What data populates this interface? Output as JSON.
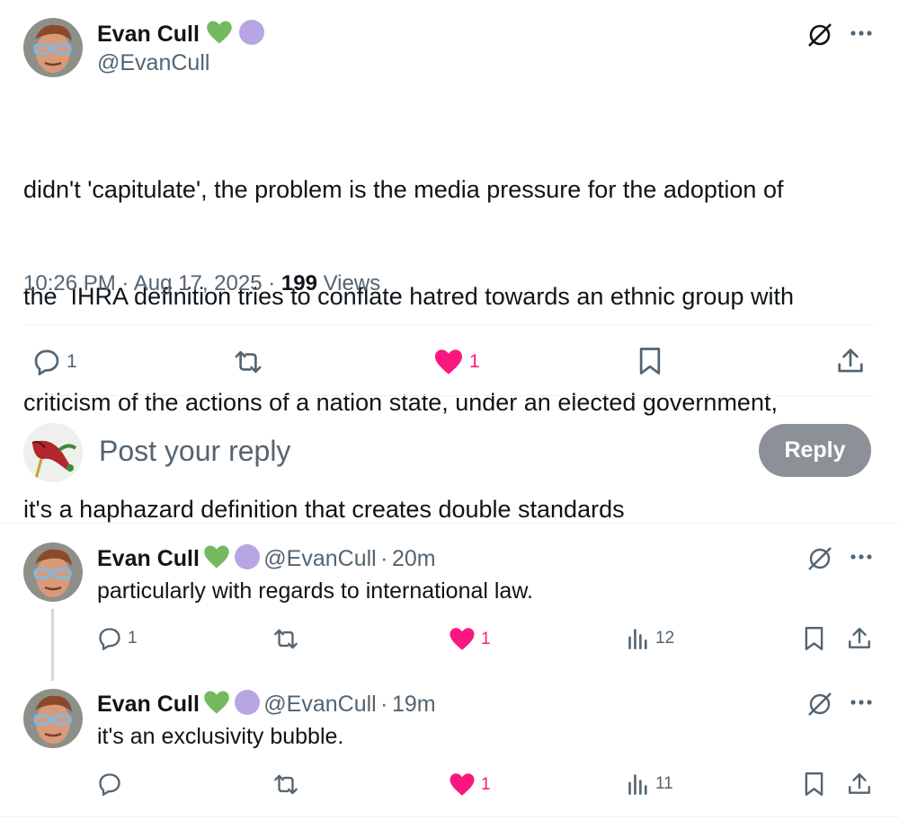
{
  "main_tweet": {
    "author_name": "Evan Cull",
    "author_handle": "@EvanCull",
    "text_lines": [
      "didn't 'capitulate', the problem is the media pressure for the adoption of",
      "the  IHRA definition tries to conflate hatred towards an ethnic group with",
      "criticism of the actions of a nation state, under an elected government,",
      "it's a haphazard definition that creates double standards"
    ],
    "time": "10:26 PM",
    "date": "Aug 17, 2025",
    "views_count": "199",
    "views_label": "Views",
    "reply_count": "1",
    "like_count": "1"
  },
  "composer": {
    "placeholder": "Post your reply",
    "reply_button": "Reply"
  },
  "replies": [
    {
      "author_name": "Evan Cull",
      "author_handle": "@EvanCull",
      "time_ago": "20m",
      "text": "particularly with regards to international law.",
      "reply_count": "1",
      "like_count": "1",
      "view_count": "12"
    },
    {
      "author_name": "Evan Cull",
      "author_handle": "@EvanCull",
      "time_ago": "19m",
      "text": "it's an exclusivity bubble.",
      "reply_count": "",
      "like_count": "1",
      "view_count": "11"
    }
  ],
  "separator": "·",
  "colors": {
    "like_pink": "#f91880",
    "badge_green": "#74b95f",
    "badge_purple": "#b8a5e3",
    "muted_gray": "#536471",
    "reply_button_bg": "#8b9196"
  }
}
